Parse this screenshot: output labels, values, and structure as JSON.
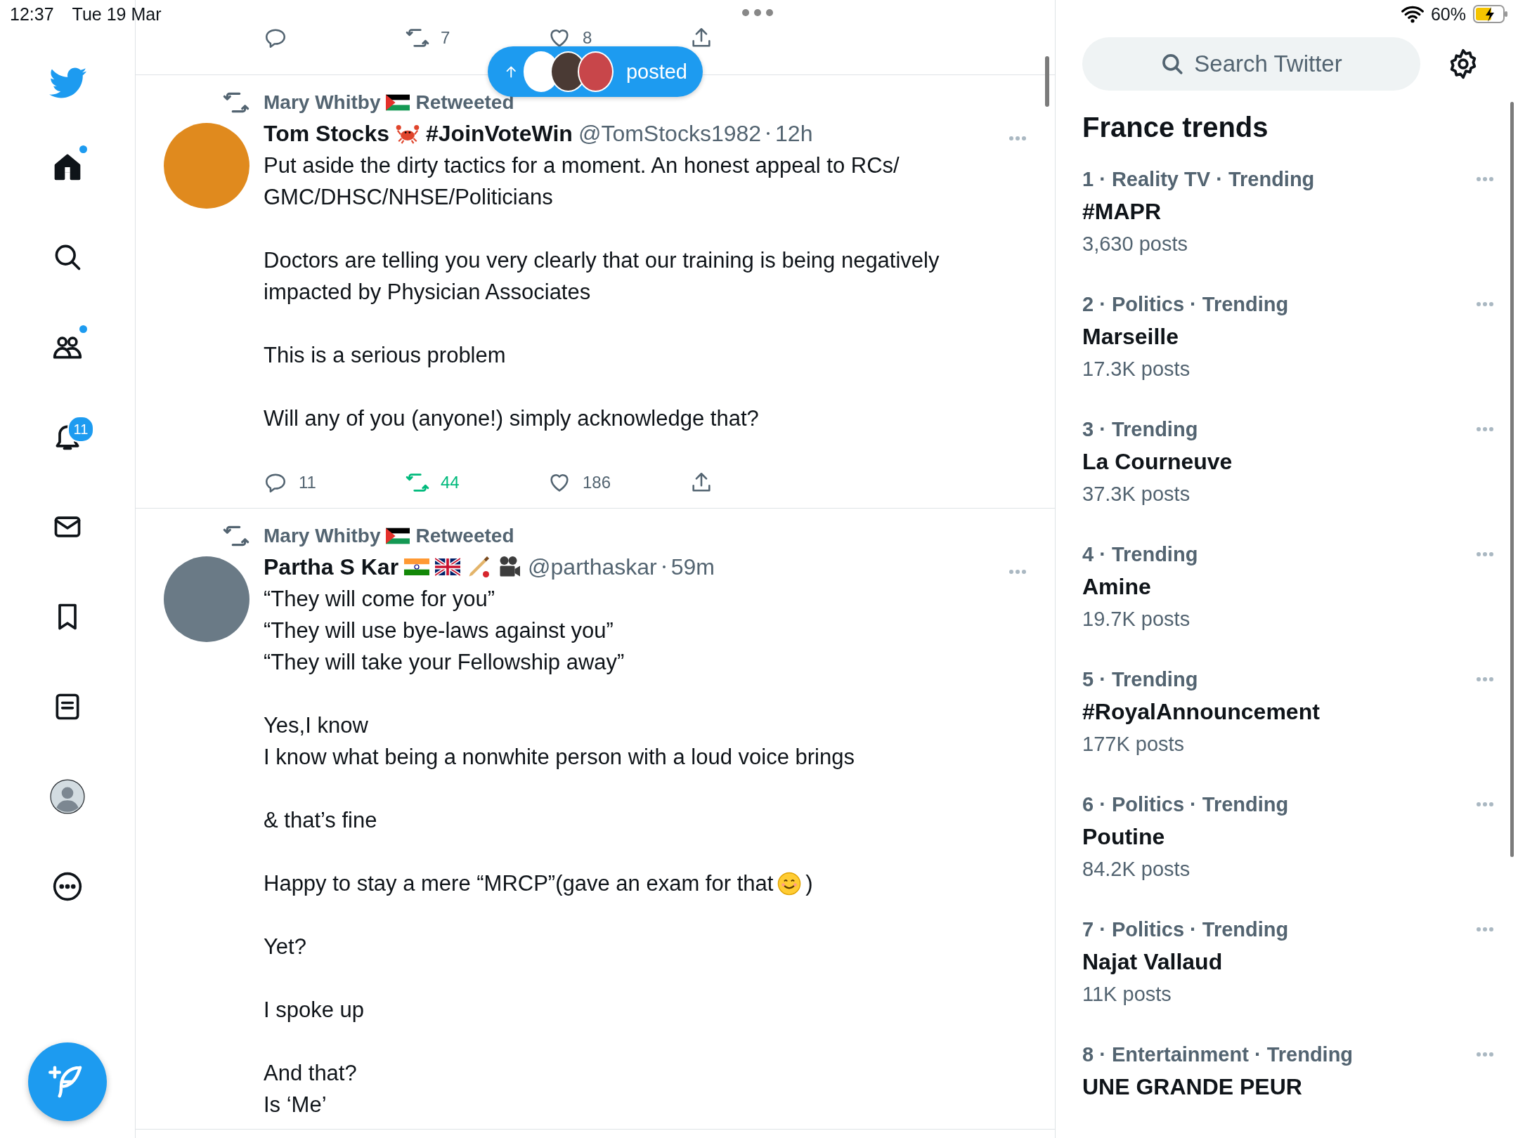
{
  "status_bar": {
    "time": "12:37",
    "date": "Tue 19 Mar",
    "battery": "60%"
  },
  "nav": [
    {
      "kind": "home",
      "selected": true,
      "dot": true
    },
    {
      "kind": "search",
      "selected": false,
      "dot": false
    },
    {
      "kind": "communities",
      "selected": false,
      "dot": true
    },
    {
      "kind": "notifications",
      "selected": false,
      "dot": false,
      "badge": "11"
    },
    {
      "kind": "messages",
      "selected": false,
      "dot": false
    },
    {
      "kind": "bookmarks",
      "selected": false,
      "dot": false
    },
    {
      "kind": "lists",
      "selected": false,
      "dot": false
    },
    {
      "kind": "profile",
      "selected": false,
      "dot": false
    },
    {
      "kind": "more",
      "selected": false,
      "dot": false
    }
  ],
  "feed": {
    "previous_tweet_actions": {
      "retweets": "7",
      "likes": "8",
      "retweeted": false
    },
    "new_posts_pill": {
      "label": "posted"
    },
    "tweets": [
      {
        "retweeted_by": "Mary Whitby",
        "retweet_label": "Retweeted",
        "name": "Tom Stocks",
        "name_extra": "#JoinVoteWin",
        "handle": "@TomStocks1982",
        "time": "12h",
        "paragraphs": [
          {
            "text": "Put aside the dirty tactics for a moment. An honest appeal to RCs/\nGMC/DHSC/NHSE/Politicians"
          },
          {
            "text": "Doctors are telling you very clearly that our training is being negatively\nimpacted by Physician Associates"
          },
          {
            "text": "This is a serious problem"
          },
          {
            "text": "Will any of you (anyone!) simply acknowledge that?"
          }
        ],
        "actions": {
          "replies": "11",
          "retweets": "44",
          "likes": "186",
          "retweeted": true
        }
      },
      {
        "retweeted_by": "Mary Whitby",
        "retweet_label": "Retweeted",
        "name": "Partha S Kar",
        "handle": "@parthaskar",
        "time": "59m",
        "paragraphs": [
          {
            "text": "“They will come for you”\n“They will use bye-laws against you”\n“They will take your Fellowship away”"
          },
          {
            "text": "Yes,I know\nI know what being a nonwhite person with a loud voice brings"
          },
          {
            "text": "& that’s fine"
          },
          {
            "text": "Happy to stay a mere “MRCP”(gave an exam for that",
            "trail": ")"
          },
          {
            "text": "Yet?"
          },
          {
            "text": "I spoke up"
          },
          {
            "text": "And that?\nIs ‘Me’"
          }
        ]
      }
    ]
  },
  "sidebar": {
    "search_placeholder": "Search Twitter",
    "title": "France trends",
    "trends": [
      {
        "meta": "1 · Reality TV · Trending",
        "name": "#MAPR",
        "posts": "3,630 posts"
      },
      {
        "meta": "2 · Politics · Trending",
        "name": "Marseille",
        "posts": "17.3K posts"
      },
      {
        "meta": "3 · Trending",
        "name": "La Courneuve",
        "posts": "37.3K posts"
      },
      {
        "meta": "4 · Trending",
        "name": "Amine",
        "posts": "19.7K posts"
      },
      {
        "meta": "5 · Trending",
        "name": "#RoyalAnnouncement",
        "posts": "177K posts"
      },
      {
        "meta": "6 · Politics · Trending",
        "name": "Poutine",
        "posts": "84.2K posts"
      },
      {
        "meta": "7 · Politics · Trending",
        "name": "Najat Vallaud",
        "posts": "11K posts"
      },
      {
        "meta": "8 · Entertainment · Trending",
        "name": "UNE GRANDE PEUR"
      }
    ]
  }
}
